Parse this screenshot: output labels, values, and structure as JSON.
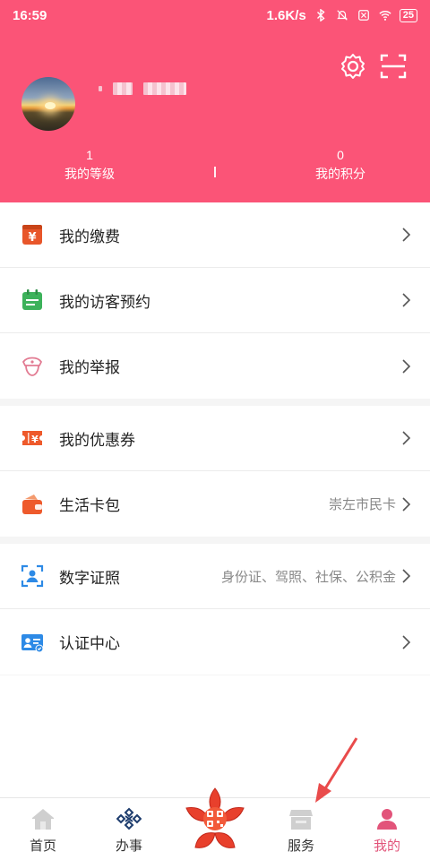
{
  "status_bar": {
    "time": "16:59",
    "speed": "1.6K/s",
    "battery": "25"
  },
  "profile": {
    "level_value": "1",
    "level_label": "我的等级",
    "points_value": "0",
    "points_label": "我的积分"
  },
  "menu_group_1": [
    {
      "label": "我的缴费",
      "icon": "payment-icon",
      "color": "#e8562a"
    },
    {
      "label": "我的访客预约",
      "icon": "calendar-icon",
      "color": "#3cb25a"
    },
    {
      "label": "我的举报",
      "icon": "police-cap-icon",
      "color": "#e27b92"
    }
  ],
  "menu_group_2": [
    {
      "label": "我的优惠券",
      "icon": "coupon-icon",
      "color": "#ee5a2c"
    },
    {
      "label": "生活卡包",
      "icon": "wallet-icon",
      "color": "#ee5a2c",
      "sub": "崇左市民卡"
    }
  ],
  "menu_group_3": [
    {
      "label": "数字证照",
      "icon": "id-scan-icon",
      "color": "#2d8ae6",
      "sub": "身份证、驾照、社保、公积金"
    },
    {
      "label": "认证中心",
      "icon": "verified-id-icon",
      "color": "#2d8ae6"
    }
  ],
  "tabbar": {
    "home": "首页",
    "affairs": "办事",
    "service": "服务",
    "mine": "我的"
  },
  "colors": {
    "header": "#fb5477",
    "active_tab": "#e2547a"
  }
}
